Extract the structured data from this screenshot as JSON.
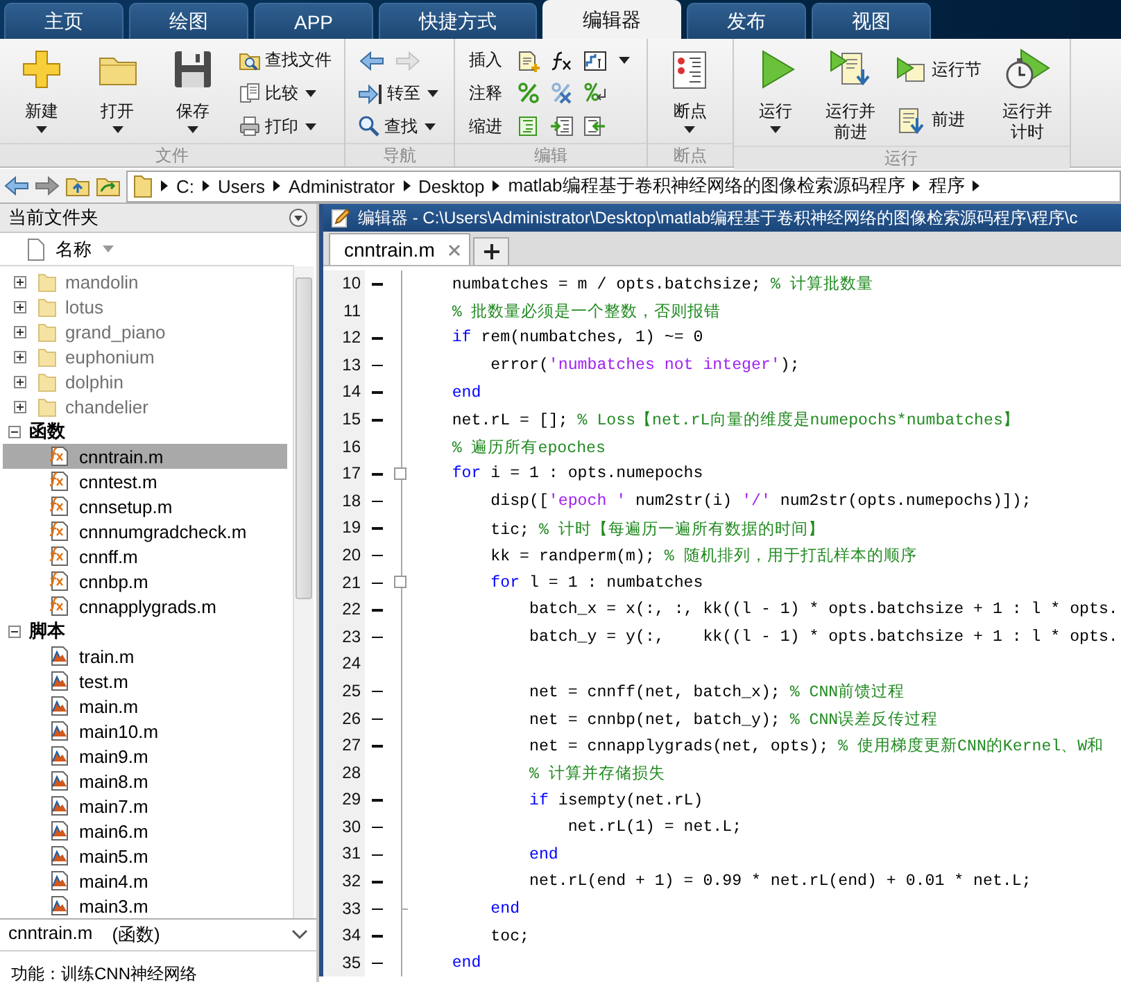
{
  "toolstrip_tabs": [
    {
      "label": "主页",
      "selected": false
    },
    {
      "label": "绘图",
      "selected": false
    },
    {
      "label": "APP",
      "selected": false
    },
    {
      "label": "快捷方式",
      "selected": false
    },
    {
      "label": "编辑器",
      "selected": true
    },
    {
      "label": "发布",
      "selected": false
    },
    {
      "label": "视图",
      "selected": false
    }
  ],
  "ribbon": [
    {
      "label": "文件",
      "controls": [
        {
          "kind": "large",
          "label": "新建",
          "dropdown": true
        },
        {
          "kind": "large",
          "label": "打开",
          "dropdown": true
        },
        {
          "kind": "large",
          "label": "保存",
          "dropdown": true
        },
        {
          "kind": "stack",
          "items": [
            {
              "kind": "button",
              "label": "查找文件",
              "dropdown": false
            },
            {
              "kind": "button",
              "label": "比较",
              "dropdown": true
            },
            {
              "kind": "button",
              "label": "打印",
              "dropdown": true
            }
          ]
        }
      ]
    },
    {
      "label": "导航",
      "controls": [
        {
          "kind": "stack",
          "items": [
            {
              "kind": "icons",
              "icons": [
                {
                  "disabled": false
                },
                {
                  "disabled": true
                }
              ]
            },
            {
              "kind": "button",
              "label": "转至",
              "dropdown": true
            },
            {
              "kind": "button",
              "label": "查找",
              "dropdown": true
            }
          ]
        }
      ]
    },
    {
      "label": "编辑",
      "controls": [
        {
          "kind": "grid",
          "rows": [
            {
              "label": "插入",
              "dropdown": true
            },
            {
              "label": "注释",
              "dropdown": false
            },
            {
              "label": "缩进",
              "dropdown": false
            }
          ]
        }
      ]
    },
    {
      "label": "断点",
      "controls": [
        {
          "kind": "large",
          "label": "断点",
          "dropdown": true
        }
      ]
    },
    {
      "label": "运行",
      "controls": [
        {
          "kind": "large",
          "label": "运行",
          "dropdown": true
        },
        {
          "kind": "large",
          "label": "运行并前进",
          "dropdown": false
        },
        {
          "kind": "stack",
          "items": [
            {
              "kind": "button",
              "label": "运行节",
              "dropdown": false
            },
            {
              "kind": "button",
              "label": "前进",
              "dropdown": false
            }
          ]
        },
        {
          "kind": "large",
          "label": "运行并计时",
          "dropdown": false
        }
      ]
    }
  ],
  "path_bar": {
    "segments": [
      "C:",
      "Users",
      "Administrator",
      "Desktop",
      "matlab编程基于卷积神经网络的图像检索源码程序",
      "程序"
    ]
  },
  "current_folder": {
    "title": "当前文件夹",
    "column": "名称",
    "items": [
      {
        "kind": "folder",
        "name": "mandolin",
        "expanded": false,
        "selected": false
      },
      {
        "kind": "folder",
        "name": "lotus",
        "expanded": false,
        "selected": false
      },
      {
        "kind": "folder",
        "name": "grand_piano",
        "expanded": false,
        "selected": false
      },
      {
        "kind": "folder",
        "name": "euphonium",
        "expanded": false,
        "selected": false
      },
      {
        "kind": "folder",
        "name": "dolphin",
        "expanded": false,
        "selected": false
      },
      {
        "kind": "folder",
        "name": "chandelier",
        "expanded": false,
        "selected": false
      },
      {
        "kind": "group",
        "name": "函数",
        "expanded": true,
        "selected": false,
        "children": [
          {
            "kind": "function",
            "name": "cnntrain.m",
            "selected": true
          },
          {
            "kind": "function",
            "name": "cnntest.m",
            "selected": false
          },
          {
            "kind": "function",
            "name": "cnnsetup.m",
            "selected": false
          },
          {
            "kind": "function",
            "name": "cnnnumgradcheck.m",
            "selected": false
          },
          {
            "kind": "function",
            "name": "cnnff.m",
            "selected": false
          },
          {
            "kind": "function",
            "name": "cnnbp.m",
            "selected": false
          },
          {
            "kind": "function",
            "name": "cnnapplygrads.m",
            "selected": false
          }
        ]
      },
      {
        "kind": "group",
        "name": "脚本",
        "expanded": true,
        "selected": false,
        "children": [
          {
            "kind": "script",
            "name": "train.m",
            "selected": false
          },
          {
            "kind": "script",
            "name": "test.m",
            "selected": false
          },
          {
            "kind": "script",
            "name": "main.m",
            "selected": false
          },
          {
            "kind": "script",
            "name": "main10.m",
            "selected": false
          },
          {
            "kind": "script",
            "name": "main9.m",
            "selected": false
          },
          {
            "kind": "script",
            "name": "main8.m",
            "selected": false
          },
          {
            "kind": "script",
            "name": "main7.m",
            "selected": false
          },
          {
            "kind": "script",
            "name": "main6.m",
            "selected": false
          },
          {
            "kind": "script",
            "name": "main5.m",
            "selected": false
          },
          {
            "kind": "script",
            "name": "main4.m",
            "selected": false
          },
          {
            "kind": "script",
            "name": "main3.m",
            "selected": false
          }
        ]
      }
    ],
    "details": {
      "file": "cnntrain.m",
      "type": "(函数)",
      "description": "功能：训练CNN神经网络"
    }
  },
  "editor": {
    "title": "编辑器 - C:\\Users\\Administrator\\Desktop\\matlab编程基于卷积神经网络的图像检索源码程序\\程序\\c",
    "tabs": [
      {
        "label": "cnntrain.m",
        "selected": true
      }
    ],
    "lines": [
      {
        "number": "10",
        "executable": true,
        "fold_start": false,
        "fold_end": false,
        "segments": [
          {
            "kind": "code",
            "text": "    numbatches = m / opts.batchsize; "
          },
          {
            "kind": "comment",
            "text": "% 计算批数量"
          }
        ]
      },
      {
        "number": "11",
        "executable": false,
        "fold_start": false,
        "fold_end": false,
        "segments": [
          {
            "kind": "comment",
            "text": "    % 批数量必须是一个整数，否则报错"
          }
        ]
      },
      {
        "number": "12",
        "executable": true,
        "fold_start": false,
        "fold_end": false,
        "segments": [
          {
            "kind": "keyword",
            "text": "    if"
          },
          {
            "kind": "code",
            "text": " rem(numbatches, 1) ~= 0"
          }
        ]
      },
      {
        "number": "13",
        "executable": true,
        "fold_start": false,
        "fold_end": false,
        "segments": [
          {
            "kind": "code",
            "text": "        error("
          },
          {
            "kind": "string",
            "text": "'numbatches not integer'"
          },
          {
            "kind": "code",
            "text": ");"
          }
        ]
      },
      {
        "number": "14",
        "executable": true,
        "fold_start": false,
        "fold_end": false,
        "segments": [
          {
            "kind": "keyword",
            "text": "    end"
          }
        ]
      },
      {
        "number": "15",
        "executable": true,
        "fold_start": false,
        "fold_end": false,
        "segments": [
          {
            "kind": "code",
            "text": "    net.rL = []; "
          },
          {
            "kind": "comment",
            "text": "% Loss【net.rL向量的维度是numepochs*numbatches】"
          }
        ]
      },
      {
        "number": "16",
        "executable": false,
        "fold_start": false,
        "fold_end": false,
        "segments": [
          {
            "kind": "comment",
            "text": "    % 遍历所有epoches"
          }
        ]
      },
      {
        "number": "17",
        "executable": true,
        "fold_start": true,
        "fold_end": false,
        "segments": [
          {
            "kind": "keyword",
            "text": "    for"
          },
          {
            "kind": "code",
            "text": " i = 1 : opts.numepochs"
          }
        ]
      },
      {
        "number": "18",
        "executable": true,
        "fold_start": false,
        "fold_end": false,
        "segments": [
          {
            "kind": "code",
            "text": "        disp(["
          },
          {
            "kind": "string",
            "text": "'epoch '"
          },
          {
            "kind": "code",
            "text": " num2str(i) "
          },
          {
            "kind": "string",
            "text": "'/'"
          },
          {
            "kind": "code",
            "text": " num2str(opts.numepochs)]);"
          }
        ]
      },
      {
        "number": "19",
        "executable": true,
        "fold_start": false,
        "fold_end": false,
        "segments": [
          {
            "kind": "code",
            "text": "        tic; "
          },
          {
            "kind": "comment",
            "text": "% 计时【每遍历一遍所有数据的时间】"
          }
        ]
      },
      {
        "number": "20",
        "executable": true,
        "fold_start": false,
        "fold_end": false,
        "segments": [
          {
            "kind": "code",
            "text": "        kk = randperm(m); "
          },
          {
            "kind": "comment",
            "text": "% 随机排列，用于打乱样本的顺序"
          }
        ]
      },
      {
        "number": "21",
        "executable": true,
        "fold_start": true,
        "fold_end": false,
        "segments": [
          {
            "kind": "keyword",
            "text": "        for"
          },
          {
            "kind": "code",
            "text": " l = 1 : numbatches"
          }
        ]
      },
      {
        "number": "22",
        "executable": true,
        "fold_start": false,
        "fold_end": false,
        "segments": [
          {
            "kind": "code",
            "text": "            batch_x = x(:, :, kk((l - 1) * opts.batchsize + 1 : l * opts."
          }
        ]
      },
      {
        "number": "23",
        "executable": true,
        "fold_start": false,
        "fold_end": false,
        "segments": [
          {
            "kind": "code",
            "text": "            batch_y = y(:,    kk((l - 1) * opts.batchsize + 1 : l * opts."
          }
        ]
      },
      {
        "number": "24",
        "executable": false,
        "fold_start": false,
        "fold_end": false
      },
      {
        "number": "25",
        "executable": true,
        "fold_start": false,
        "fold_end": false,
        "segments": [
          {
            "kind": "code",
            "text": "            net = cnnff(net, batch_x); "
          },
          {
            "kind": "comment",
            "text": "% CNN前馈过程"
          }
        ]
      },
      {
        "number": "26",
        "executable": true,
        "fold_start": false,
        "fold_end": false,
        "segments": [
          {
            "kind": "code",
            "text": "            net = cnnbp(net, batch_y); "
          },
          {
            "kind": "comment",
            "text": "% CNN误差反传过程"
          }
        ]
      },
      {
        "number": "27",
        "executable": true,
        "fold_start": false,
        "fold_end": false,
        "segments": [
          {
            "kind": "code",
            "text": "            net = cnnapplygrads(net, opts); "
          },
          {
            "kind": "comment",
            "text": "% 使用梯度更新CNN的Kernel、W和"
          }
        ]
      },
      {
        "number": "28",
        "executable": false,
        "fold_start": false,
        "fold_end": false,
        "segments": [
          {
            "kind": "comment",
            "text": "            % 计算并存储损失"
          }
        ]
      },
      {
        "number": "29",
        "executable": true,
        "fold_start": false,
        "fold_end": false,
        "segments": [
          {
            "kind": "keyword",
            "text": "            if"
          },
          {
            "kind": "code",
            "text": " isempty(net.rL)"
          }
        ]
      },
      {
        "number": "30",
        "executable": true,
        "fold_start": false,
        "fold_end": false,
        "segments": [
          {
            "kind": "code",
            "text": "                net.rL(1) = net.L;"
          }
        ]
      },
      {
        "number": "31",
        "executable": true,
        "fold_start": false,
        "fold_end": false,
        "segments": [
          {
            "kind": "keyword",
            "text": "            end"
          }
        ]
      },
      {
        "number": "32",
        "executable": true,
        "fold_start": false,
        "fold_end": false,
        "segments": [
          {
            "kind": "code",
            "text": "            net.rL(end + 1) = 0.99 * net.rL(end) + 0.01 * net.L;"
          }
        ]
      },
      {
        "number": "33",
        "executable": true,
        "fold_start": false,
        "fold_end": true,
        "segments": [
          {
            "kind": "keyword",
            "text": "        end"
          }
        ]
      },
      {
        "number": "34",
        "executable": true,
        "fold_start": false,
        "fold_end": false,
        "segments": [
          {
            "kind": "code",
            "text": "        toc;"
          }
        ]
      },
      {
        "number": "35",
        "executable": true,
        "fold_start": false,
        "fold_end": false,
        "segments": [
          {
            "kind": "keyword",
            "text": "    end"
          }
        ]
      }
    ]
  }
}
